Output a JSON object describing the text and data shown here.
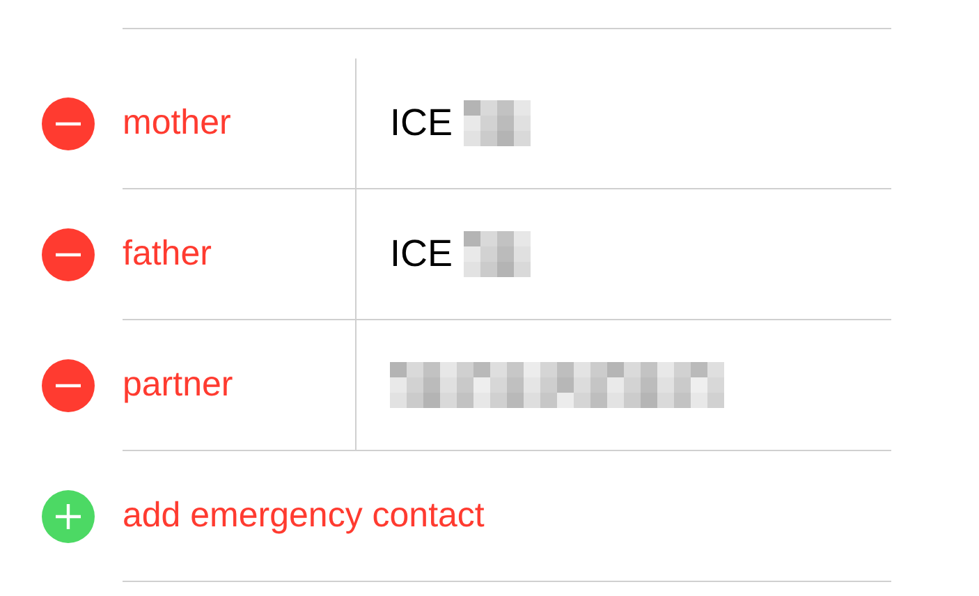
{
  "contacts": [
    {
      "label": "mother",
      "value": "ICE",
      "redacted": true
    },
    {
      "label": "father",
      "value": "ICE",
      "redacted": true
    },
    {
      "label": "partner",
      "redacted": true
    }
  ],
  "add_action": {
    "label": "add emergency contact"
  }
}
